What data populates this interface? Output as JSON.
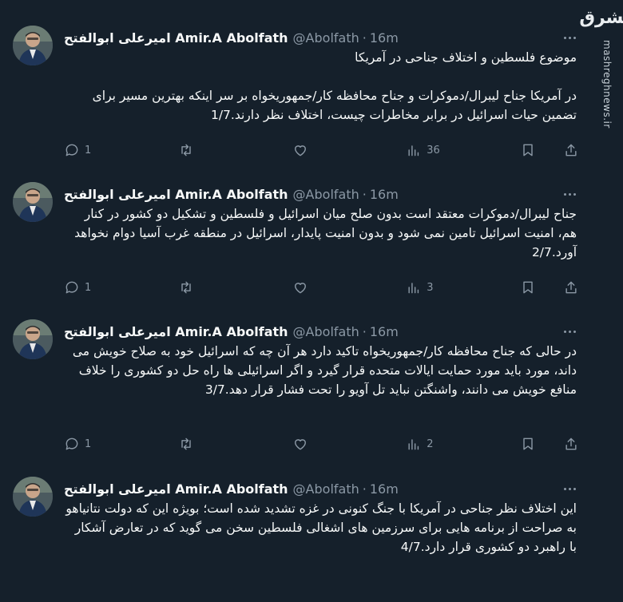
{
  "watermark": {
    "logo_text": "مشرق",
    "site": "mashreghnews.ir"
  },
  "author": {
    "name": "امیرعلی ابوالفتح Amir.A Abolfath",
    "handle": "@Abolfath",
    "separator": "·",
    "time": "16m"
  },
  "tweets": [
    {
      "text": "موضوع فلسطین و اختلاف جناحی در آمریکا\n\nدر آمریکا جناح لیبرال/دموکرات و جناح محافظه کار/جمهوریخواه بر سر اینکه بهترین مسیر برای تضمین حیات اسرائیل در برابر مخاطرات چیست، اختلاف نظر دارند.1/7",
      "replies": "1",
      "retweets": "",
      "likes": "",
      "views": "36"
    },
    {
      "text": "جناح لیبرال/دموکرات معتقد است بدون صلح میان اسرائیل و فلسطین و تشکیل دو کشور در کنار هم، امنیت اسرائیل تامین نمی شود و بدون امنیت پایدار، اسرائیل در منطقه غرب آسیا دوام نخواهد آورد.2/7",
      "replies": "1",
      "retweets": "",
      "likes": "",
      "views": "3"
    },
    {
      "text": "در حالی که جناح محافظه کار/جمهوریخواه تاکید دارد هر آن چه که اسرائیل خود به صلاح خویش می داند، مورد باید مورد حمایت ایالات متحده قرار گیرد و اگر اسرائیلی ها راه حل دو کشوری را خلاف منافع خویش می دانند، واشنگتن نباید تل آویو را تحت فشار قرار دهد.3/7",
      "replies": "1",
      "retweets": "",
      "likes": "",
      "views": "2"
    },
    {
      "text": "این اختلاف نظر جناحی در آمریکا با جنگ کنونی در غزه تشدید شده است؛ بویژه این که دولت نتانیاهو به صراحت از برنامه هایی برای سرزمین های اشغالی فلسطین سخن می گوید که در تعارض آشکار با راهبرد دو کشوری قرار دارد.4/7",
      "replies": "",
      "retweets": "",
      "likes": "",
      "views": ""
    }
  ]
}
